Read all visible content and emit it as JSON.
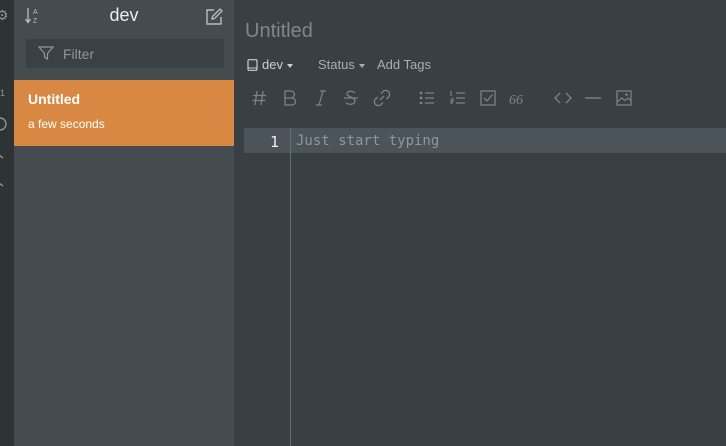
{
  "colors": {
    "accent": "#d98844",
    "sidebar_bg": "#454c50",
    "editor_bg": "#393f42",
    "active_line_bg": "#4b545a"
  },
  "rail": {
    "icons": [
      "gear-icon",
      "clock-icon",
      "chevron-icon",
      "chevron-icon"
    ],
    "marker_text": "1"
  },
  "sidebar": {
    "title": "dev",
    "sort_icon": "sort-az-icon",
    "compose_icon": "compose-icon",
    "filter": {
      "placeholder": "Filter",
      "icon": "filter-icon"
    },
    "notes": [
      {
        "title": "Untitled",
        "time": "a few seconds"
      }
    ]
  },
  "editor": {
    "title": "Untitled",
    "notebook": {
      "label": "dev",
      "icon": "notebook-icon"
    },
    "status_label": "Status",
    "tags_label": "Add Tags",
    "toolbar": [
      "heading-icon",
      "bold-icon",
      "italic-icon",
      "strikethrough-icon",
      "link-icon",
      "bullet-list-icon",
      "numbered-list-icon",
      "checkbox-icon",
      "quote-icon",
      "code-icon",
      "horizontal-rule-icon",
      "image-icon"
    ],
    "line_number": "1",
    "placeholder_text": "Just start typing"
  }
}
